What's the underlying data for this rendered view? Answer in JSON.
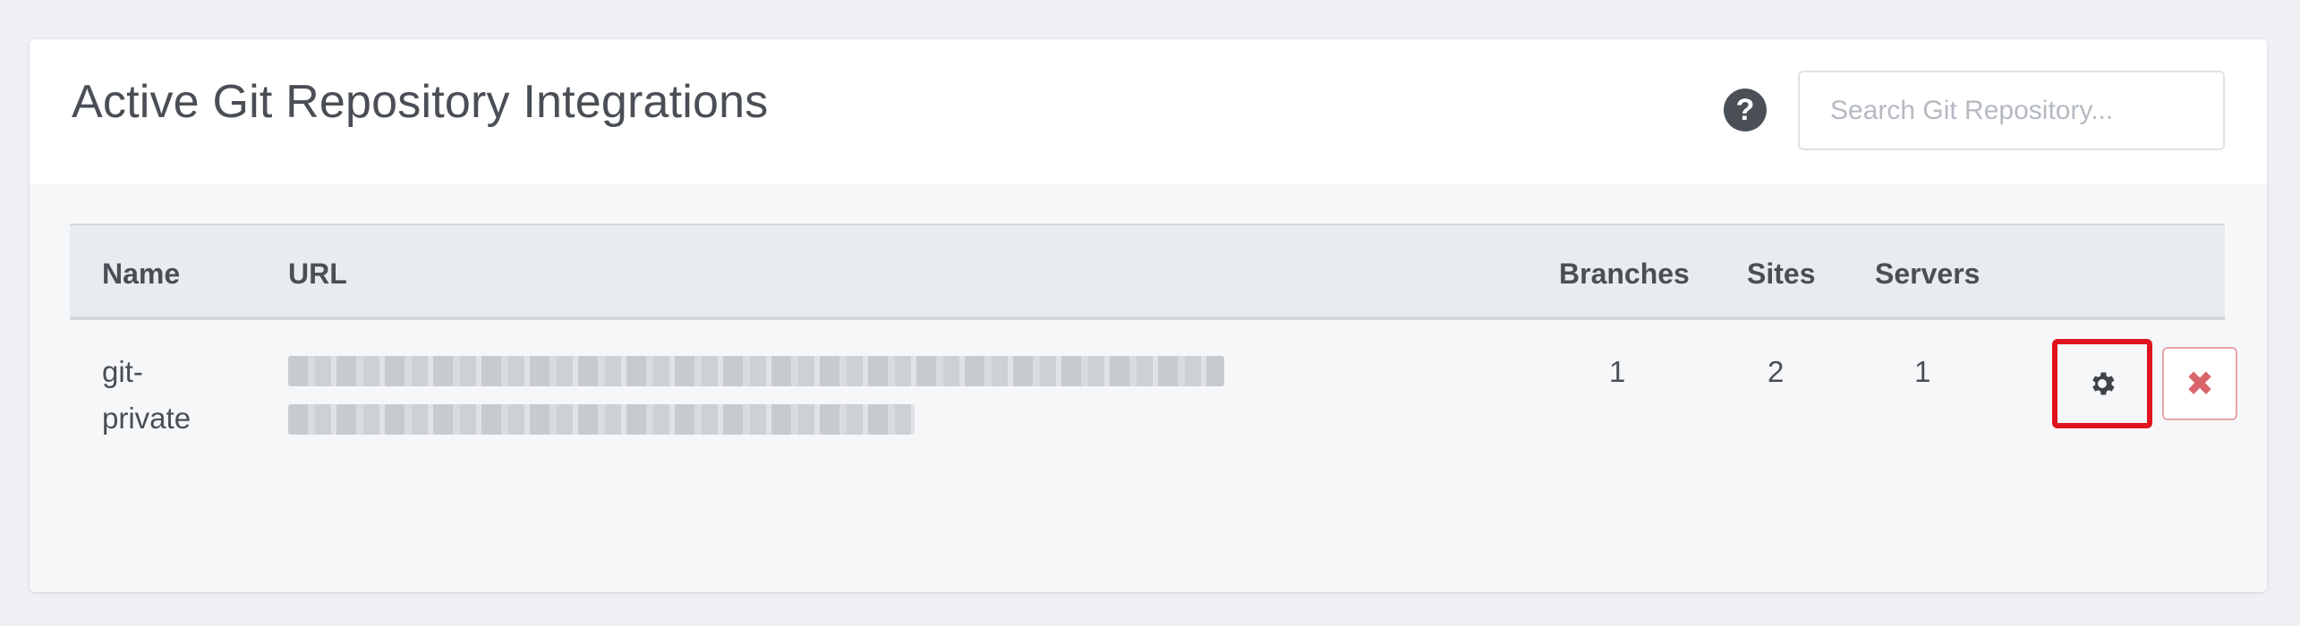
{
  "header": {
    "title": "Active Git Repository Integrations",
    "help_icon": "question-circle-icon",
    "search_placeholder": "Search Git Repository..."
  },
  "table": {
    "columns": [
      "Name",
      "URL",
      "Branches",
      "Sites",
      "Servers"
    ],
    "rows": [
      {
        "name_line1": "git-",
        "name_line2": "private",
        "url": "(blurred)",
        "branches": "1",
        "sites": "2",
        "servers": "1",
        "settings_icon": "gear-icon",
        "delete_icon": "close-icon",
        "delete_glyph": "✖"
      }
    ]
  },
  "colors": {
    "highlight": "#e0141e",
    "delete": "#d9646b"
  }
}
